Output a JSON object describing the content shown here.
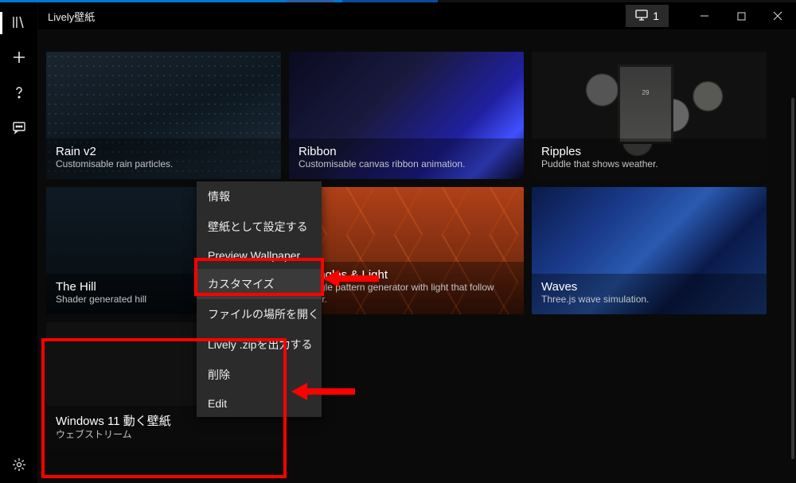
{
  "app": {
    "title": "Lively壁紙",
    "monitor_label": "1"
  },
  "sidebar": {
    "items": [
      {
        "name": "library",
        "glyph": "library"
      },
      {
        "name": "add",
        "glyph": "plus"
      },
      {
        "name": "help",
        "glyph": "question"
      },
      {
        "name": "feedback",
        "glyph": "chat"
      }
    ],
    "bottom": {
      "name": "settings",
      "glyph": "gear"
    }
  },
  "wallpapers": [
    {
      "id": "rain",
      "title": "Rain v2",
      "sub": "Customisable rain particles."
    },
    {
      "id": "ribbon",
      "title": "Ribbon",
      "sub": "Customisable canvas ribbon animation."
    },
    {
      "id": "ripples",
      "title": "Ripples",
      "sub": "Puddle that shows weather.",
      "weather_badge": "29"
    },
    {
      "id": "hill",
      "title": "The Hill",
      "sub": "Shader generated hill"
    },
    {
      "id": "triangles",
      "title": "Triangles & Light",
      "sub": "Triangle pattern generator with light that follow cursor."
    },
    {
      "id": "waves",
      "title": "Waves",
      "sub": "Three.js wave simulation."
    },
    {
      "id": "win11",
      "title": "Windows 11 動く壁紙",
      "sub": "ウェブストリーム"
    }
  ],
  "context_menu": {
    "items": [
      "情報",
      "壁紙として設定する",
      "Preview Wallpaper",
      "カスタマイズ",
      "ファイルの場所を開く",
      "Lively .zipを出力する",
      "削除",
      "Edit"
    ],
    "hover_index": 3
  }
}
